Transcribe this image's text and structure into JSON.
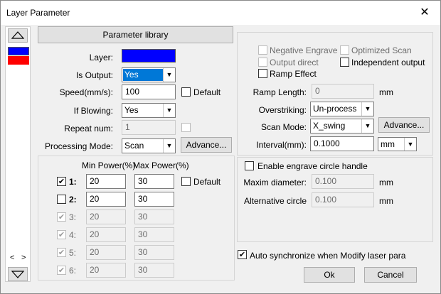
{
  "window": {
    "title": "Layer Parameter"
  },
  "colors": {
    "layer_primary": "#0000ff",
    "layer_secondary": "#ff0000",
    "selection": "#0078d7"
  },
  "icons": {
    "close": "close-icon",
    "scroll_up": "triangle-up-icon",
    "scroll_down": "triangle-down-icon",
    "scroll_left": "chevron-left-icon",
    "scroll_right": "chevron-right-icon"
  },
  "left": {
    "param_library_btn": "Parameter library",
    "layer_label": "Layer:",
    "is_output_label": "Is Output:",
    "is_output_value": "Yes",
    "speed_label": "Speed(mm/s):",
    "speed_value": "100",
    "default_label": "Default",
    "if_blowing_label": "If Blowing:",
    "if_blowing_value": "Yes",
    "repeat_label": "Repeat num:",
    "repeat_value": "1",
    "processing_label": "Processing Mode:",
    "processing_value": "Scan",
    "advance_btn": "Advance...",
    "scroll_left_glyph": "<",
    "scroll_right_glyph": ">"
  },
  "power": {
    "min_header": "Min Power(%)",
    "max_header": "Max Power(%)",
    "default_label": "Default",
    "rows": [
      {
        "label": "1:",
        "min": "20",
        "max": "30",
        "checked": "✔"
      },
      {
        "label": "2:",
        "min": "20",
        "max": "30",
        "checked": ""
      },
      {
        "label": "3:",
        "min": "20",
        "max": "30",
        "checked": "✔"
      },
      {
        "label": "4:",
        "min": "20",
        "max": "30",
        "checked": "✔"
      },
      {
        "label": "5:",
        "min": "20",
        "max": "30",
        "checked": "✔"
      },
      {
        "label": "6:",
        "min": "20",
        "max": "30",
        "checked": "✔"
      }
    ]
  },
  "right": {
    "negative_engrave": "Negative Engrave",
    "optimized_scan": "Optimized Scan",
    "output_direct": "Output direct",
    "independent_output": "Independent output",
    "ramp_effect": "Ramp Effect",
    "ramp_length_label": "Ramp Length:",
    "ramp_length_value": "0",
    "unit_mm": "mm",
    "overstriking_label": "Overstriking:",
    "overstriking_value": "Un-process",
    "scan_mode_label": "Scan Mode:",
    "scan_mode_value": "X_swing",
    "advance_btn": "Advance...",
    "interval_label": "Interval(mm):",
    "interval_value": "0.1000",
    "interval_unit": "mm",
    "engrave_circle": "Enable engrave circle handle",
    "maxim_label": "Maxim diameter:",
    "maxim_value": "0.100",
    "alt_circle_label": "Alternative circle",
    "alt_circle_value": "0.100"
  },
  "footer": {
    "auto_sync": "Auto synchronize when Modify laser para",
    "ok": "Ok",
    "cancel": "Cancel"
  }
}
